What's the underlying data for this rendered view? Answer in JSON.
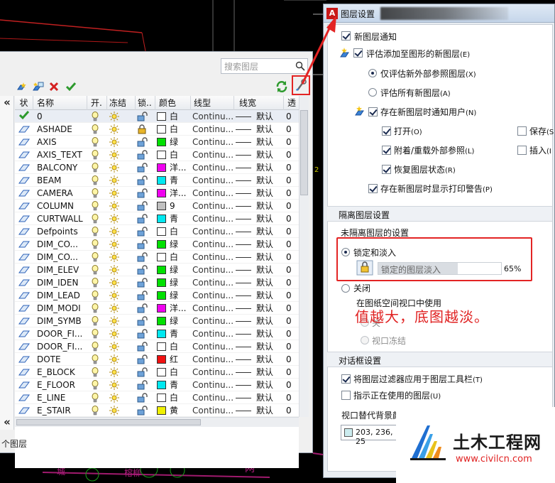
{
  "layer_manager": {
    "search_placeholder": "搜索图层",
    "columns": [
      "状",
      "名称",
      "开.",
      "冻结",
      "锁..",
      "颜色",
      "线型",
      "线宽",
      "透"
    ],
    "rows": [
      {
        "name": "0",
        "color_name": "白",
        "color": "#ffffff",
        "linetype": "Continu...",
        "lineweight": "默认",
        "transparency": "0",
        "current": true,
        "locked": false
      },
      {
        "name": "ASHADE",
        "color_name": "白",
        "color": "#ffffff",
        "linetype": "Continu...",
        "lineweight": "默认",
        "transparency": "0",
        "current": false,
        "locked": true
      },
      {
        "name": "AXIS",
        "color_name": "绿",
        "color": "#00e000",
        "linetype": "Continu...",
        "lineweight": "默认",
        "transparency": "0",
        "current": false,
        "locked": false
      },
      {
        "name": "AXIS_TEXT",
        "color_name": "白",
        "color": "#ffffff",
        "linetype": "Continu...",
        "lineweight": "默认",
        "transparency": "0",
        "current": false,
        "locked": false
      },
      {
        "name": "BALCONY",
        "color_name": "洋...",
        "color": "#f000f0",
        "linetype": "Continu...",
        "lineweight": "默认",
        "transparency": "0",
        "current": false,
        "locked": false
      },
      {
        "name": "BEAM",
        "color_name": "青",
        "color": "#00e8f0",
        "linetype": "Continu...",
        "lineweight": "默认",
        "transparency": "0",
        "current": false,
        "locked": false
      },
      {
        "name": "CAMERA",
        "color_name": "洋...",
        "color": "#f000f0",
        "linetype": "Continu...",
        "lineweight": "默认",
        "transparency": "0",
        "current": false,
        "locked": false
      },
      {
        "name": "COLUMN",
        "color_name": "9",
        "color": "#c0c0c0",
        "linetype": "Continu...",
        "lineweight": "默认",
        "transparency": "0",
        "current": false,
        "locked": false
      },
      {
        "name": "CURTWALL",
        "color_name": "青",
        "color": "#00e8f0",
        "linetype": "Continu...",
        "lineweight": "默认",
        "transparency": "0",
        "current": false,
        "locked": false
      },
      {
        "name": "Defpoints",
        "color_name": "白",
        "color": "#ffffff",
        "linetype": "Continu...",
        "lineweight": "默认",
        "transparency": "0",
        "current": false,
        "locked": false
      },
      {
        "name": "DIM_CO...",
        "color_name": "绿",
        "color": "#00e000",
        "linetype": "Continu...",
        "lineweight": "默认",
        "transparency": "0",
        "current": false,
        "locked": false
      },
      {
        "name": "DIM_CO...",
        "color_name": "白",
        "color": "#ffffff",
        "linetype": "Continu...",
        "lineweight": "默认",
        "transparency": "0",
        "current": false,
        "locked": false
      },
      {
        "name": "DIM_ELEV",
        "color_name": "绿",
        "color": "#00e000",
        "linetype": "Continu...",
        "lineweight": "默认",
        "transparency": "0",
        "current": false,
        "locked": false
      },
      {
        "name": "DIM_IDEN",
        "color_name": "绿",
        "color": "#00e000",
        "linetype": "Continu...",
        "lineweight": "默认",
        "transparency": "0",
        "current": false,
        "locked": false
      },
      {
        "name": "DIM_LEAD",
        "color_name": "绿",
        "color": "#00e000",
        "linetype": "Continu...",
        "lineweight": "默认",
        "transparency": "0",
        "current": false,
        "locked": false
      },
      {
        "name": "DIM_MODI",
        "color_name": "洋...",
        "color": "#f000f0",
        "linetype": "Continu...",
        "lineweight": "默认",
        "transparency": "0",
        "current": false,
        "locked": false
      },
      {
        "name": "DIM_SYMB",
        "color_name": "绿",
        "color": "#00e000",
        "linetype": "Continu...",
        "lineweight": "默认",
        "transparency": "0",
        "current": false,
        "locked": false
      },
      {
        "name": "DOOR_FI...",
        "color_name": "青",
        "color": "#00e8f0",
        "linetype": "Continu...",
        "lineweight": "默认",
        "transparency": "0",
        "current": false,
        "locked": false
      },
      {
        "name": "DOOR_FI...",
        "color_name": "白",
        "color": "#ffffff",
        "linetype": "Continu...",
        "lineweight": "默认",
        "transparency": "0",
        "current": false,
        "locked": false
      },
      {
        "name": "DOTE",
        "color_name": "红",
        "color": "#f01010",
        "linetype": "Continu...",
        "lineweight": "默认",
        "transparency": "0",
        "current": false,
        "locked": false
      },
      {
        "name": "E_BLOCK",
        "color_name": "白",
        "color": "#ffffff",
        "linetype": "Continu...",
        "lineweight": "默认",
        "transparency": "0",
        "current": false,
        "locked": false
      },
      {
        "name": "E_FLOOR",
        "color_name": "青",
        "color": "#00e8f0",
        "linetype": "Continu...",
        "lineweight": "默认",
        "transparency": "0",
        "current": false,
        "locked": false
      },
      {
        "name": "E_LINE",
        "color_name": "白",
        "color": "#ffffff",
        "linetype": "Continu...",
        "lineweight": "默认",
        "transparency": "0",
        "current": false,
        "locked": false
      },
      {
        "name": "E_STAIR",
        "color_name": "黄",
        "color": "#f0f000",
        "linetype": "Continu...",
        "lineweight": "默认",
        "transparency": "0",
        "current": false,
        "locked": false
      }
    ],
    "status_text": "个图层",
    "collapse_glyph": "«"
  },
  "dialog": {
    "app_icon": "A",
    "title": "图层设置",
    "new_layer_notify": "新图层通知",
    "eval_new_layers": "评估添加至图形的新图层",
    "eval_new_layers_key": "(E)",
    "only_xref": "仅评估新外部参照图层",
    "only_xref_key": "(X)",
    "all_new": "评估所有新图层",
    "all_new_key": "(A)",
    "notify_user": "存在新图层时通知用户",
    "notify_user_key": "(N)",
    "open": "打开",
    "open_key": "(O)",
    "save": "保存",
    "save_key": "(S",
    "attach": "附着/重载外部参照",
    "attach_key": "(L)",
    "insert": "插入",
    "insert_key": "(I",
    "restore": "恢复图层状态",
    "restore_key": "(R)",
    "plot_warn": "存在新图层时显示打印警告",
    "plot_warn_key": "(P)",
    "isolate_section": "隔离图层设置",
    "unisolated": "未隔离图层的设置",
    "lock_fade": "锁定和淡入",
    "fade_label": "锁定的图层淡入",
    "fade_percent": "65%",
    "fade_value": 0.65,
    "off": "关闭",
    "paper_vp": "在图纸空间视口中使用",
    "off_opt": "关",
    "vp_freeze": "视口冻结",
    "dialog_section": "对话框设置",
    "apply_filter": "将图层过滤器应用于图层工具栏",
    "apply_filter_key": "(T)",
    "indicate_used": "指示正在使用的图层",
    "indicate_used_key": "(U)",
    "vp_bg": "视口替代背景颜",
    "bg_value": "203, 236, 25"
  },
  "annotation": {
    "text": "值越大，底图越淡。",
    "color": "#e02222"
  },
  "watermark": {
    "cn": "土木工程网",
    "url": "www.civilcn.com"
  },
  "icons": [
    "new-layer-icon",
    "new-vp-layer-icon",
    "delete-layer-icon",
    "set-current-icon",
    "refresh-icon",
    "settings-wrench-icon",
    "search-icon",
    "bulb-icon",
    "sun-icon",
    "unlock-icon",
    "lock-icon",
    "layer-parallelogram-icon",
    "current-check-icon"
  ]
}
